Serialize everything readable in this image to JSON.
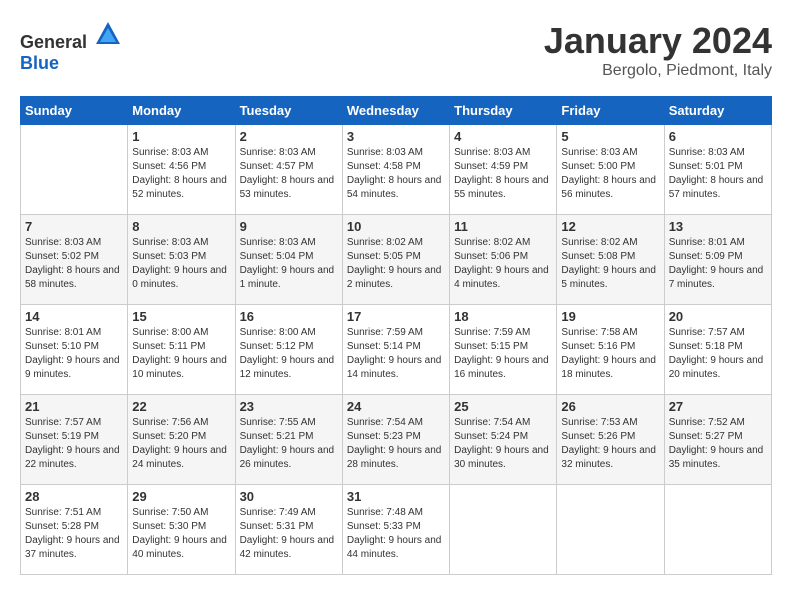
{
  "header": {
    "logo_general": "General",
    "logo_blue": "Blue",
    "month": "January 2024",
    "location": "Bergolo, Piedmont, Italy"
  },
  "weekdays": [
    "Sunday",
    "Monday",
    "Tuesday",
    "Wednesday",
    "Thursday",
    "Friday",
    "Saturday"
  ],
  "weeks": [
    [
      {
        "day": "",
        "sunrise": "",
        "sunset": "",
        "daylight": ""
      },
      {
        "day": "1",
        "sunrise": "Sunrise: 8:03 AM",
        "sunset": "Sunset: 4:56 PM",
        "daylight": "Daylight: 8 hours and 52 minutes."
      },
      {
        "day": "2",
        "sunrise": "Sunrise: 8:03 AM",
        "sunset": "Sunset: 4:57 PM",
        "daylight": "Daylight: 8 hours and 53 minutes."
      },
      {
        "day": "3",
        "sunrise": "Sunrise: 8:03 AM",
        "sunset": "Sunset: 4:58 PM",
        "daylight": "Daylight: 8 hours and 54 minutes."
      },
      {
        "day": "4",
        "sunrise": "Sunrise: 8:03 AM",
        "sunset": "Sunset: 4:59 PM",
        "daylight": "Daylight: 8 hours and 55 minutes."
      },
      {
        "day": "5",
        "sunrise": "Sunrise: 8:03 AM",
        "sunset": "Sunset: 5:00 PM",
        "daylight": "Daylight: 8 hours and 56 minutes."
      },
      {
        "day": "6",
        "sunrise": "Sunrise: 8:03 AM",
        "sunset": "Sunset: 5:01 PM",
        "daylight": "Daylight: 8 hours and 57 minutes."
      }
    ],
    [
      {
        "day": "7",
        "sunrise": "Sunrise: 8:03 AM",
        "sunset": "Sunset: 5:02 PM",
        "daylight": "Daylight: 8 hours and 58 minutes."
      },
      {
        "day": "8",
        "sunrise": "Sunrise: 8:03 AM",
        "sunset": "Sunset: 5:03 PM",
        "daylight": "Daylight: 9 hours and 0 minutes."
      },
      {
        "day": "9",
        "sunrise": "Sunrise: 8:03 AM",
        "sunset": "Sunset: 5:04 PM",
        "daylight": "Daylight: 9 hours and 1 minute."
      },
      {
        "day": "10",
        "sunrise": "Sunrise: 8:02 AM",
        "sunset": "Sunset: 5:05 PM",
        "daylight": "Daylight: 9 hours and 2 minutes."
      },
      {
        "day": "11",
        "sunrise": "Sunrise: 8:02 AM",
        "sunset": "Sunset: 5:06 PM",
        "daylight": "Daylight: 9 hours and 4 minutes."
      },
      {
        "day": "12",
        "sunrise": "Sunrise: 8:02 AM",
        "sunset": "Sunset: 5:08 PM",
        "daylight": "Daylight: 9 hours and 5 minutes."
      },
      {
        "day": "13",
        "sunrise": "Sunrise: 8:01 AM",
        "sunset": "Sunset: 5:09 PM",
        "daylight": "Daylight: 9 hours and 7 minutes."
      }
    ],
    [
      {
        "day": "14",
        "sunrise": "Sunrise: 8:01 AM",
        "sunset": "Sunset: 5:10 PM",
        "daylight": "Daylight: 9 hours and 9 minutes."
      },
      {
        "day": "15",
        "sunrise": "Sunrise: 8:00 AM",
        "sunset": "Sunset: 5:11 PM",
        "daylight": "Daylight: 9 hours and 10 minutes."
      },
      {
        "day": "16",
        "sunrise": "Sunrise: 8:00 AM",
        "sunset": "Sunset: 5:12 PM",
        "daylight": "Daylight: 9 hours and 12 minutes."
      },
      {
        "day": "17",
        "sunrise": "Sunrise: 7:59 AM",
        "sunset": "Sunset: 5:14 PM",
        "daylight": "Daylight: 9 hours and 14 minutes."
      },
      {
        "day": "18",
        "sunrise": "Sunrise: 7:59 AM",
        "sunset": "Sunset: 5:15 PM",
        "daylight": "Daylight: 9 hours and 16 minutes."
      },
      {
        "day": "19",
        "sunrise": "Sunrise: 7:58 AM",
        "sunset": "Sunset: 5:16 PM",
        "daylight": "Daylight: 9 hours and 18 minutes."
      },
      {
        "day": "20",
        "sunrise": "Sunrise: 7:57 AM",
        "sunset": "Sunset: 5:18 PM",
        "daylight": "Daylight: 9 hours and 20 minutes."
      }
    ],
    [
      {
        "day": "21",
        "sunrise": "Sunrise: 7:57 AM",
        "sunset": "Sunset: 5:19 PM",
        "daylight": "Daylight: 9 hours and 22 minutes."
      },
      {
        "day": "22",
        "sunrise": "Sunrise: 7:56 AM",
        "sunset": "Sunset: 5:20 PM",
        "daylight": "Daylight: 9 hours and 24 minutes."
      },
      {
        "day": "23",
        "sunrise": "Sunrise: 7:55 AM",
        "sunset": "Sunset: 5:21 PM",
        "daylight": "Daylight: 9 hours and 26 minutes."
      },
      {
        "day": "24",
        "sunrise": "Sunrise: 7:54 AM",
        "sunset": "Sunset: 5:23 PM",
        "daylight": "Daylight: 9 hours and 28 minutes."
      },
      {
        "day": "25",
        "sunrise": "Sunrise: 7:54 AM",
        "sunset": "Sunset: 5:24 PM",
        "daylight": "Daylight: 9 hours and 30 minutes."
      },
      {
        "day": "26",
        "sunrise": "Sunrise: 7:53 AM",
        "sunset": "Sunset: 5:26 PM",
        "daylight": "Daylight: 9 hours and 32 minutes."
      },
      {
        "day": "27",
        "sunrise": "Sunrise: 7:52 AM",
        "sunset": "Sunset: 5:27 PM",
        "daylight": "Daylight: 9 hours and 35 minutes."
      }
    ],
    [
      {
        "day": "28",
        "sunrise": "Sunrise: 7:51 AM",
        "sunset": "Sunset: 5:28 PM",
        "daylight": "Daylight: 9 hours and 37 minutes."
      },
      {
        "day": "29",
        "sunrise": "Sunrise: 7:50 AM",
        "sunset": "Sunset: 5:30 PM",
        "daylight": "Daylight: 9 hours and 40 minutes."
      },
      {
        "day": "30",
        "sunrise": "Sunrise: 7:49 AM",
        "sunset": "Sunset: 5:31 PM",
        "daylight": "Daylight: 9 hours and 42 minutes."
      },
      {
        "day": "31",
        "sunrise": "Sunrise: 7:48 AM",
        "sunset": "Sunset: 5:33 PM",
        "daylight": "Daylight: 9 hours and 44 minutes."
      },
      {
        "day": "",
        "sunrise": "",
        "sunset": "",
        "daylight": ""
      },
      {
        "day": "",
        "sunrise": "",
        "sunset": "",
        "daylight": ""
      },
      {
        "day": "",
        "sunrise": "",
        "sunset": "",
        "daylight": ""
      }
    ]
  ]
}
